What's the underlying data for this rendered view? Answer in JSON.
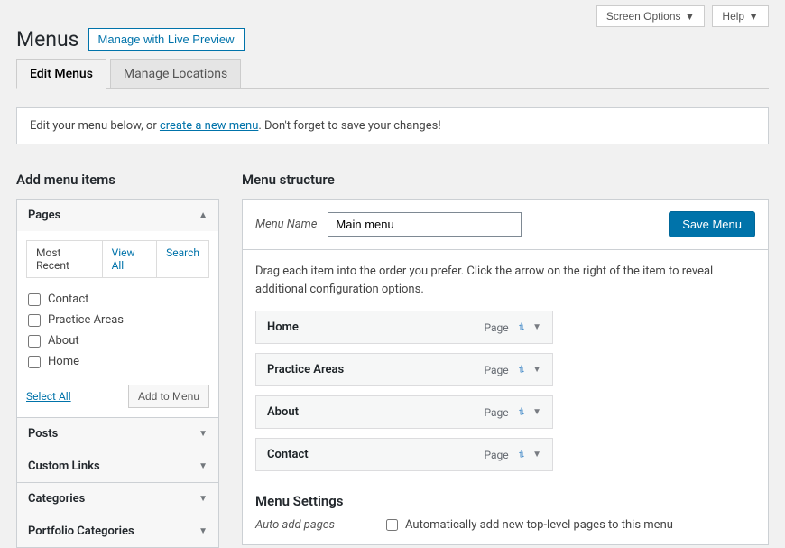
{
  "topbar": {
    "screen_options": "Screen Options",
    "help": "Help"
  },
  "page_title": "Menus",
  "live_preview_btn": "Manage with Live Preview",
  "tabs": {
    "edit": "Edit Menus",
    "locations": "Manage Locations"
  },
  "notice": {
    "prefix": "Edit your menu below, or ",
    "link": "create a new menu",
    "suffix": ". Don't forget to save your changes!"
  },
  "left": {
    "title": "Add menu items",
    "panels": {
      "pages": "Pages",
      "posts": "Posts",
      "custom_links": "Custom Links",
      "categories": "Categories",
      "portfolio_categories": "Portfolio Categories"
    },
    "subtabs": {
      "recent": "Most Recent",
      "view_all": "View All",
      "search": "Search"
    },
    "page_items": [
      "Contact",
      "Practice Areas",
      "About",
      "Home"
    ],
    "select_all": "Select All",
    "add_to_menu": "Add to Menu"
  },
  "right": {
    "title": "Menu structure",
    "menu_name_label": "Menu Name",
    "menu_name_value": "Main menu",
    "save_btn": "Save Menu",
    "drag_info": "Drag each item into the order you prefer. Click the arrow on the right of the item to reveal additional configuration options.",
    "items": [
      {
        "title": "Home",
        "type": "Page"
      },
      {
        "title": "Practice Areas",
        "type": "Page"
      },
      {
        "title": "About",
        "type": "Page"
      },
      {
        "title": "Contact",
        "type": "Page"
      }
    ],
    "settings_title": "Menu Settings",
    "auto_add_label": "Auto add pages",
    "auto_add_text": "Automatically add new top-level pages to this menu"
  }
}
